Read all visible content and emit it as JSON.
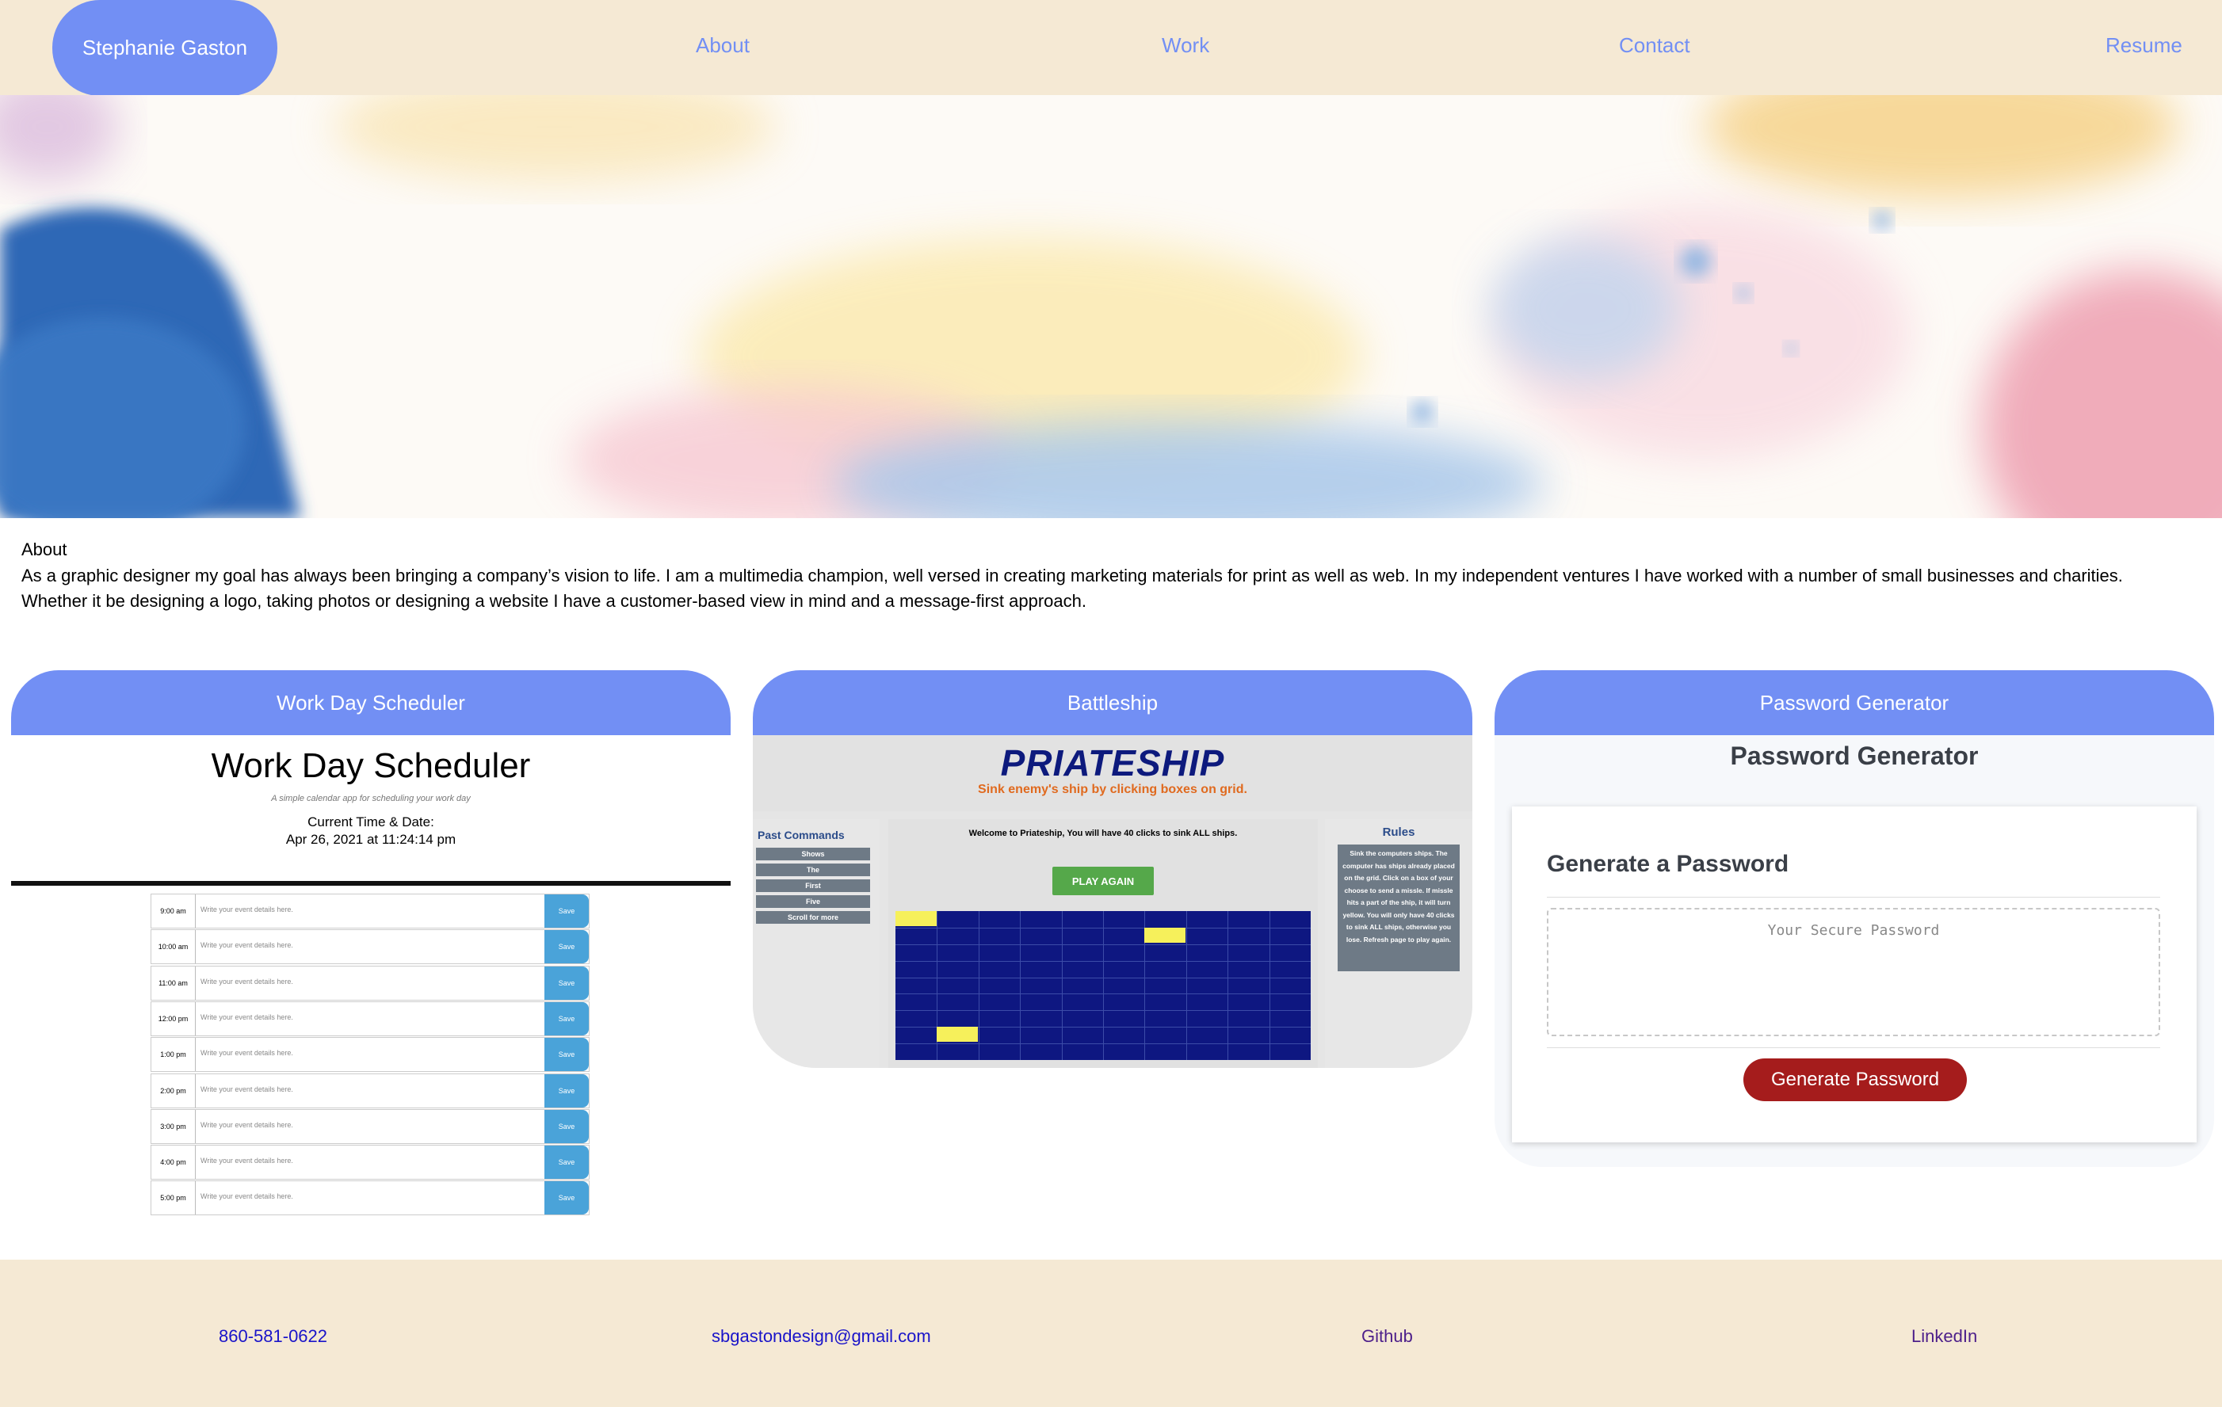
{
  "header": {
    "brand": "Stephanie Gaston",
    "nav": [
      {
        "label": "About"
      },
      {
        "label": "Work"
      },
      {
        "label": "Contact"
      },
      {
        "label": "Resume"
      }
    ]
  },
  "hero": {
    "image": "watercolor-banner"
  },
  "about": {
    "heading": "About",
    "text": "As a graphic designer my goal has always been bringing a company’s vision to life. I am a multimedia champion, well versed in creating marketing materials for print as well as web. In my independent ventures I have worked with a number of small businesses and charities. Whether it be designing a logo, taking photos or designing a website I have a customer-based view in mind and a message-first approach."
  },
  "projects": [
    {
      "title": "Work Day Scheduler",
      "preview": {
        "heading": "Work Day Scheduler",
        "subtitle": "A simple calendar app for scheduling your work day",
        "time_label": "Current Time & Date:",
        "time_value": "Apr 26, 2021 at 11:24:14 pm",
        "placeholder": "Write your event details here.",
        "save_label": "Save",
        "hours": [
          "9:00 am",
          "10:00 am",
          "11:00 am",
          "12:00 pm",
          "1:00 pm",
          "2:00 pm",
          "3:00 pm",
          "4:00 pm",
          "5:00 pm"
        ]
      }
    },
    {
      "title": "Battleship",
      "preview": {
        "logo": "PRIATESHIP",
        "tagline": "Sink enemy's ship by clicking boxes on grid.",
        "past_commands_heading": "Past Commands",
        "commands": [
          "Shows",
          "The",
          "First",
          "Five",
          "Scroll for more"
        ],
        "welcome": "Welcome to Priateship, You will have 40 clicks to sink ALL ships.",
        "play_again": "PLAY AGAIN",
        "rules_heading": "Rules",
        "rules": "Sink the computers ships. The computer has ships already placed on the grid. Click on a box of your choose to send a missle. If missle hits a part of the ship, it will turn yellow. You will only have 40 clicks to sink ALL ships, otherwise you lose. Refresh page to play again.",
        "hit_color": "#f6f05b",
        "grid_color": "#0e1781"
      }
    },
    {
      "title": "Password Generator",
      "preview": {
        "heading": "Password Generator",
        "card_heading": "Generate a Password",
        "placeholder": "Your Secure Password",
        "button": "Generate Password",
        "button_color": "#a51c1c"
      }
    }
  ],
  "footer": {
    "phone": "860-581-0622",
    "email": "sbgastondesign@gmail.com",
    "github": "Github",
    "linkedin": "LinkedIn"
  },
  "colors": {
    "accent": "#728ff4",
    "header_bg": "#f5e9d4"
  }
}
